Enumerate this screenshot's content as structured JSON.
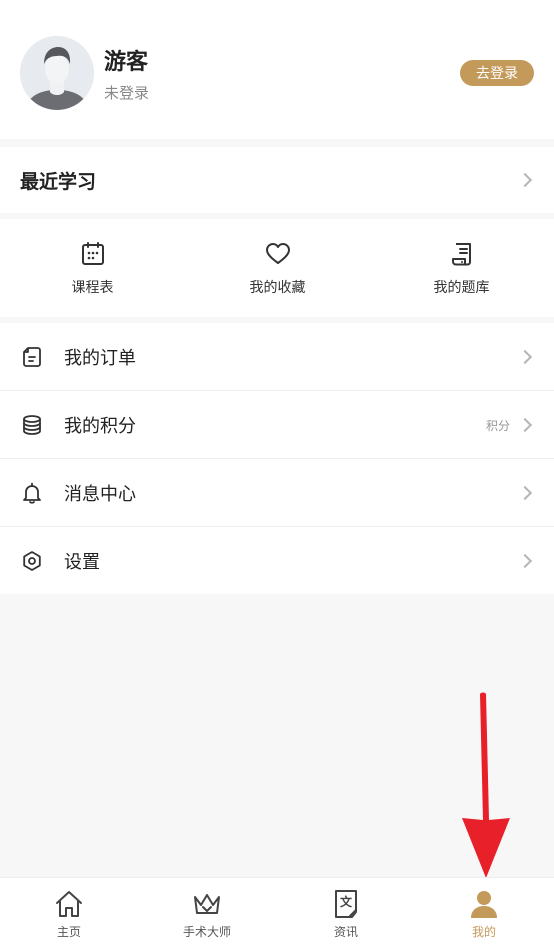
{
  "profile": {
    "name": "游客",
    "status": "未登录",
    "login_label": "去登录"
  },
  "recent": {
    "title": "最近学习"
  },
  "quick": [
    {
      "label": "课程表",
      "icon": "calendar-icon"
    },
    {
      "label": "我的收藏",
      "icon": "heart-icon"
    },
    {
      "label": "我的题库",
      "icon": "question-bank-icon"
    }
  ],
  "menu": [
    {
      "label": "我的订单",
      "icon": "order-icon",
      "extra": ""
    },
    {
      "label": "我的积分",
      "icon": "points-icon",
      "extra": "积分"
    },
    {
      "label": "消息中心",
      "icon": "bell-icon",
      "extra": ""
    },
    {
      "label": "设置",
      "icon": "settings-icon",
      "extra": ""
    }
  ],
  "tabs": [
    {
      "label": "主页",
      "icon": "home-icon"
    },
    {
      "label": "手术大师",
      "icon": "crown-icon"
    },
    {
      "label": "资讯",
      "icon": "news-icon"
    },
    {
      "label": "我的",
      "icon": "user-icon",
      "active": true
    }
  ],
  "colors": {
    "accent": "#c49a5b",
    "annotation_arrow": "#e8202a"
  }
}
